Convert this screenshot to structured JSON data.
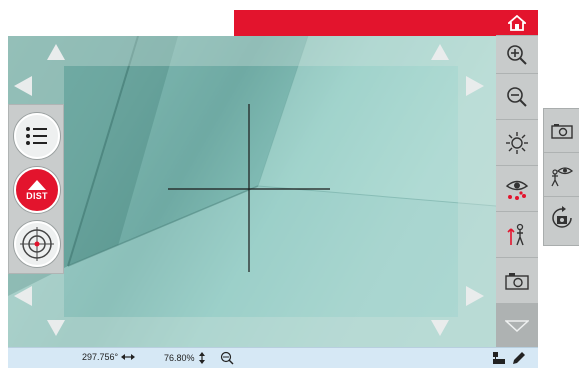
{
  "toolbar": {
    "home_icon": "home-icon",
    "zoom_in_icon": "zoom-in-icon",
    "zoom_out_icon": "zoom-out-icon",
    "brightness_icon": "brightness-icon",
    "eye_icon": "eye-points-icon",
    "station_icon": "station-setup-icon",
    "camera_icon": "camera-icon",
    "more_icon": "chevron-down-icon"
  },
  "left_panel": {
    "list_icon": "list-icon",
    "dist_label": "DIST",
    "target_icon": "target-icon"
  },
  "side_popout": {
    "icons": [
      "camera-icon",
      "eye-person-icon",
      "rotate-camera-icon"
    ]
  },
  "status_bar": {
    "horizontal_angle": "297.756°",
    "zoom_percent": "76.80%",
    "search_icon": "zoom-search-icon",
    "connection_icon": "connection-icon",
    "pen_icon": "pen-icon"
  },
  "colors": {
    "accent_red": "#e3142d",
    "toolbar_gray": "#c8cbcb",
    "status_blue": "#d6e8f5"
  }
}
